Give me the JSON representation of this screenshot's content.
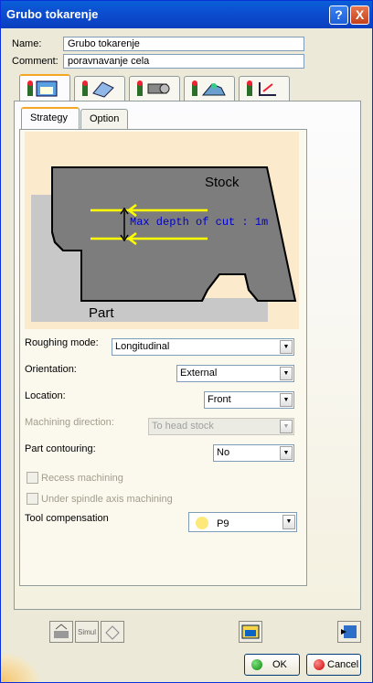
{
  "window": {
    "title": "Grubo tokarenje"
  },
  "form": {
    "name_label": "Name:",
    "name_value": "Grubo tokarenje",
    "comment_label": "Comment:",
    "comment_value": "poravnavanje cela"
  },
  "main_tabs": [
    {
      "icon": "strategy-tab-icon"
    },
    {
      "icon": "geometry-tab-icon"
    },
    {
      "icon": "tool-tab-icon"
    },
    {
      "icon": "feeds-speeds-tab-icon"
    },
    {
      "icon": "macros-tab-icon"
    }
  ],
  "sub_tabs": {
    "strategy": "Strategy",
    "option": "Option"
  },
  "diagram": {
    "stock_label": "Stock",
    "part_label": "Part",
    "depth_label": "Max depth of cut : 1m"
  },
  "params": {
    "roughing_mode_label": "Roughing mode:",
    "roughing_mode_value": "Longitudinal",
    "orientation_label": "Orientation:",
    "orientation_value": "External",
    "location_label": "Location:",
    "location_value": "Front",
    "machining_direction_label": "Machining direction:",
    "machining_direction_value": "To head stock",
    "part_contouring_label": "Part contouring:",
    "part_contouring_value": "No",
    "recess_label": "Recess machining",
    "under_spindle_label": "Under spindle axis machining",
    "tool_comp_label": "Tool compensation",
    "tool_comp_value": "P9"
  },
  "buttons": {
    "ok": "OK",
    "cancel": "Cancel",
    "help": "?",
    "close": "X"
  },
  "colors": {
    "title_bar": "#0a4fd0",
    "stock": "#7d7d7d",
    "part": "#c8c8c8",
    "cut_lines": "#ffff00",
    "depth_text": "#0000cc"
  }
}
